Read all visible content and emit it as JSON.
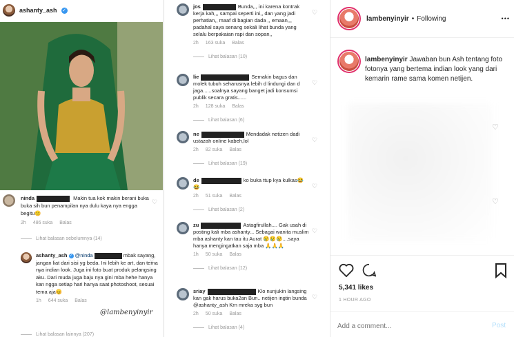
{
  "left_panel": {
    "username": "ashanty_ash",
    "comment1": {
      "username": "ninda",
      "text": "Makin tua kok makin berani buka buka sih bun penampilan nya dulu kaya nya engga begitu😑",
      "time": "2h",
      "likes": "486 suka",
      "reply": "Balas"
    },
    "view_previous": "Lihat balasan sebelumnya (14)",
    "reply": {
      "username": "ashanty_ash",
      "mention": "@ninda",
      "text": "mbak sayang, jangan liat dari sisi yg beda. Ini lebih ke art, dan tema nya indian look. Juga ini foto buat produk pelangsing aku. Dari muda juga baju nya gini mba hehe hanya kan ngga setiap hari hanya saat photoshoot, sesuai tema aja😊",
      "time": "1h",
      "likes": "644 suka",
      "reply": "Balas",
      "signature": "@lambenyinyir"
    },
    "view_more": "Lihat balasan lainnya (207)"
  },
  "middle_panel": {
    "comments": [
      {
        "username": "jos",
        "text": "Bunda,,, ini karena kontrak kerja kah,,, sampai seperti ini,, dan yang jadi perhatian,, maaf di bagian dada ,, emaan,,, padahal saya senang sekali lihat bunda yang selalu berpakaian rapi dan sopan,,",
        "time": "2h",
        "likes": "163 suka",
        "reply": "Balas",
        "view": "Lihat balasan (10)"
      },
      {
        "username": "lie",
        "text": "Semakin bagus dan molek tubuh seharusnya lebih d lindungi dan d jaga......soalnya sayang banget jadi konsumsi publik secara gratis......",
        "time": "2h",
        "likes": "128 suka",
        "reply": "Balas",
        "view": "Lihat balasan (6)"
      },
      {
        "username": "ne",
        "text": "Mendadak netizen dadi ustazah online kabeh,lol",
        "time": "2h",
        "likes": "82 suka",
        "reply": "Balas",
        "view": "Lihat balasan (19)"
      },
      {
        "username": "de",
        "text": "ko buka ttup kya kulkas😂😂",
        "time": "2h",
        "likes": "51 suka",
        "reply": "Balas",
        "view": "Lihat balasan (2)"
      },
      {
        "username": "zu",
        "text": "Astagfirullah.... Gak usah di posting kali mba ashanty... Sebagai wanita muslim mba ashanty kan tau itu Aurat 😢😢😢....saya hanya mengingatkan saja mba 🙏🙏🙏",
        "time": "1h",
        "likes": "50 suka",
        "reply": "Balas",
        "view": "Lihat balasan (12)"
      },
      {
        "username": "sriay",
        "text": "Klo nunjukin langsing kan gak harus buka2an Bun.. netijen ingtin bunda @ashanty_ash Krn mreka syg bun",
        "time": "2h",
        "likes": "50 suka",
        "reply": "Balas",
        "view": "Lihat balasan (4)"
      }
    ]
  },
  "right_panel": {
    "username": "lambenyinyir",
    "following": "Following",
    "more": "•••",
    "caption_user": "lambenyinyir",
    "caption": "Jawaban bun Ash tentang foto fotonya yang bertema indian look yang dari kemarin rame sama komen netijen.",
    "likes": "5,341 likes",
    "time_ago": "1 HOUR AGO",
    "add_comment_placeholder": "Add a comment...",
    "post_button": "Post"
  },
  "colors": {
    "link": "#3897f0",
    "muted": "#999999",
    "post_disabled": "#b2dffc"
  }
}
